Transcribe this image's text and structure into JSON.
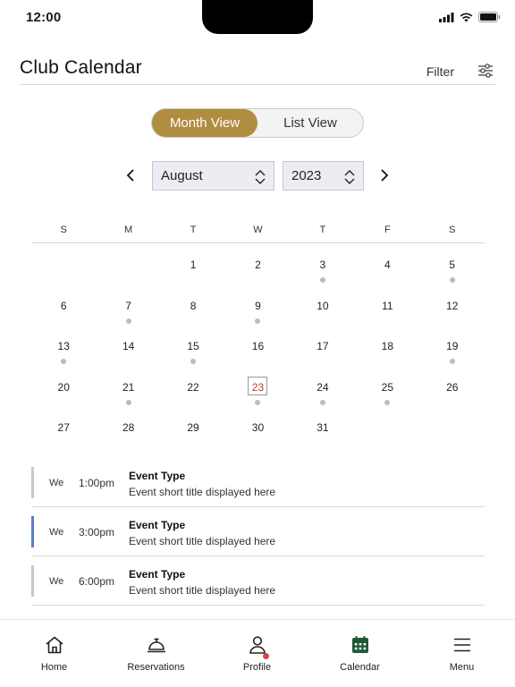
{
  "status_bar": {
    "time": "12:00",
    "icons": [
      "cellular-signal-icon",
      "wifi-icon",
      "battery-icon"
    ]
  },
  "header": {
    "title": "Club Calendar",
    "filter_label": "Filter",
    "filter_icon": "sliders-icon"
  },
  "view_toggle": {
    "options": [
      "Month View",
      "List View"
    ],
    "selected": "Month View",
    "active_color": "#b08d3f"
  },
  "month_nav": {
    "month_value": "August",
    "year_value": "2023",
    "prev_icon": "chevron-left-icon",
    "next_icon": "chevron-right-icon"
  },
  "calendar": {
    "weekdays": [
      "S",
      "M",
      "T",
      "W",
      "T",
      "F",
      "S"
    ],
    "weeks": [
      [
        null,
        null,
        {
          "day": "1"
        },
        {
          "day": "2"
        },
        {
          "day": "3",
          "event": true
        },
        {
          "day": "4"
        },
        {
          "day": "5",
          "event": true
        }
      ],
      [
        {
          "day": "6"
        },
        {
          "day": "7",
          "event": true
        },
        {
          "day": "8"
        },
        {
          "day": "9",
          "event": true
        },
        {
          "day": "10"
        },
        {
          "day": "11"
        },
        {
          "day": "12"
        }
      ],
      [
        {
          "day": "13",
          "event": true
        },
        {
          "day": "14"
        },
        {
          "day": "15",
          "event": true
        },
        {
          "day": "16"
        },
        {
          "day": "17"
        },
        {
          "day": "18"
        },
        {
          "day": "19",
          "event": true
        }
      ],
      [
        {
          "day": "20"
        },
        {
          "day": "21",
          "event": true
        },
        {
          "day": "22"
        },
        {
          "day": "23",
          "event": true,
          "today": true
        },
        {
          "day": "24",
          "event": true
        },
        {
          "day": "25",
          "event": true
        },
        {
          "day": "26"
        }
      ],
      [
        {
          "day": "27"
        },
        {
          "day": "28"
        },
        {
          "day": "29"
        },
        {
          "day": "30"
        },
        {
          "day": "31"
        },
        null,
        null
      ]
    ],
    "today_color": "#c0392b",
    "dot_color": "#b9bcc0"
  },
  "events": [
    {
      "day": "We",
      "time": "1:00pm",
      "type": "Event Type",
      "title": "Event short title displayed here",
      "bar_color": "#c9c9c9"
    },
    {
      "day": "We",
      "time": "3:00pm",
      "type": "Event Type",
      "title": "Event short title displayed here",
      "bar_color": "#5b80c4"
    },
    {
      "day": "We",
      "time": "6:00pm",
      "type": "Event Type",
      "title": "Event short title displayed here",
      "bar_color": "#c9c9c9"
    }
  ],
  "tab_bar": {
    "items": [
      {
        "label": "Home",
        "icon": "home-icon"
      },
      {
        "label": "Reservations",
        "icon": "service-bell-icon"
      },
      {
        "label": "Profile",
        "icon": "person-icon",
        "badge": true
      },
      {
        "label": "Calendar",
        "icon": "calendar-icon",
        "active": true
      },
      {
        "label": "Menu",
        "icon": "hamburger-menu-icon"
      }
    ],
    "active_color": "#1f5a36",
    "badge_color": "#d64545"
  }
}
